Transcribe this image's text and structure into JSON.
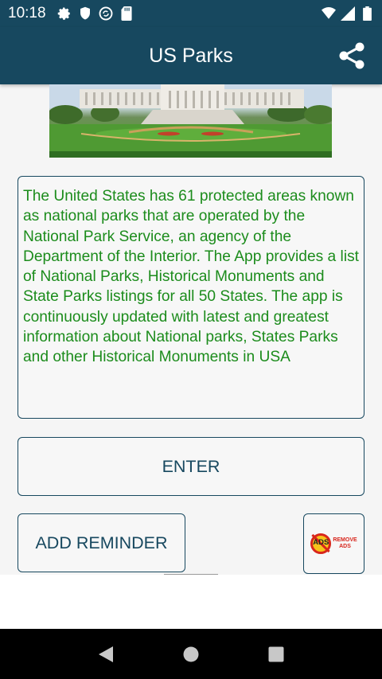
{
  "status_bar": {
    "time": "10:18",
    "left_icons": [
      "gear-icon",
      "shield-icon",
      "sync-icon",
      "sd-card-icon"
    ],
    "right_icons": [
      "wifi-icon",
      "signal-icon",
      "battery-icon"
    ]
  },
  "app_bar": {
    "title": "US Parks",
    "share_icon": "share-icon",
    "background": "#17485f"
  },
  "hero_image": {
    "subject": "capitol-building-photo"
  },
  "description": {
    "text": "The United States has 61 protected areas known as national parks that are operated by the National Park Service, an agency of the Department of the Interior. The App provides a list of National Parks, Historical Monuments and State Parks listings for all 50 States. The app is continuously updated with latest and greatest information about National parks, States Parks and other Historical Monuments in USA",
    "color": "#1c8c1c"
  },
  "buttons": {
    "enter_label": "ENTER",
    "add_reminder_label": "ADD REMINDER",
    "remove_ads": {
      "badge_text": "ADS",
      "label_line1": "REMOVE",
      "label_line2": "ADS"
    }
  },
  "nav_bar": {
    "items": [
      "back-icon",
      "home-icon",
      "recents-icon"
    ]
  }
}
